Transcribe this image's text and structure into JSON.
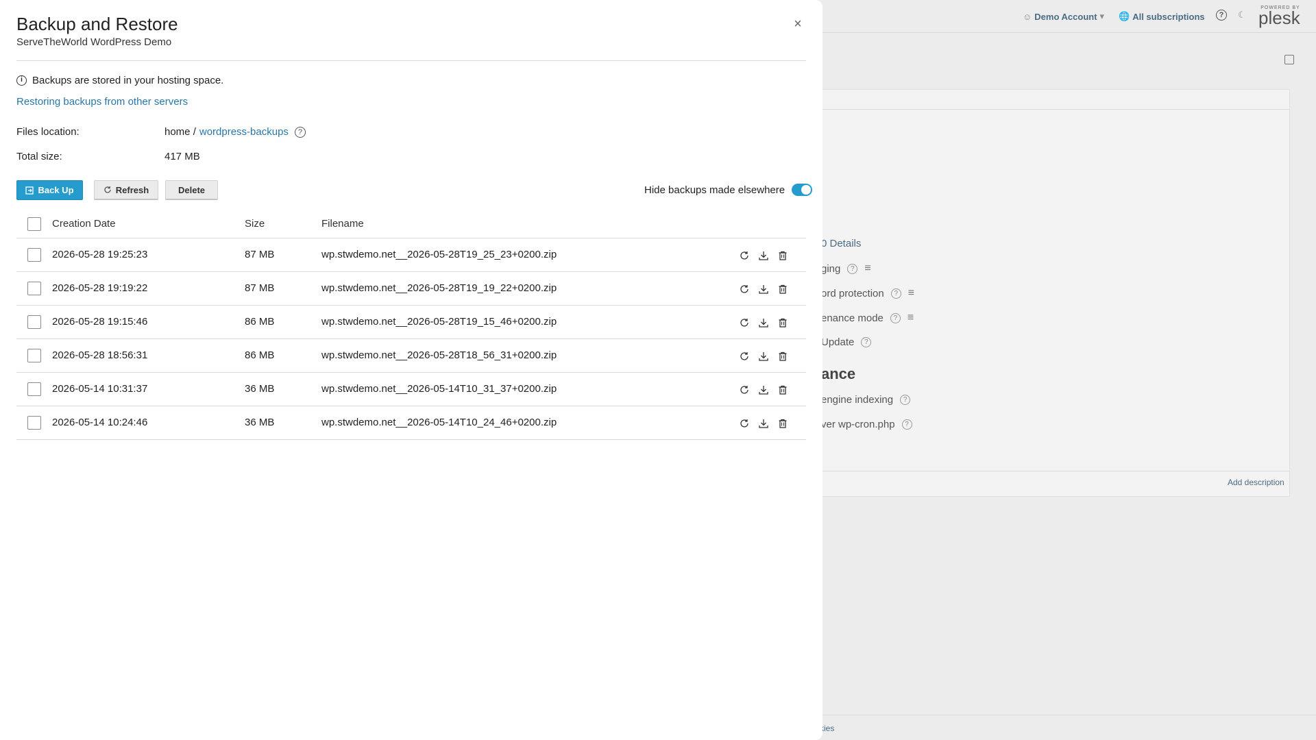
{
  "background": {
    "header": {
      "account_label": "Demo Account",
      "subscriptions_label": "All subscriptions",
      "logo_powered_by": "POWERED BY",
      "logo_text": "plesk"
    },
    "rows": [
      {
        "text": "0 Details"
      },
      {
        "text": "ging"
      },
      {
        "text": "ord protection"
      },
      {
        "text": "enance mode"
      },
      {
        "text": "Update"
      },
      {
        "text": "ance"
      },
      {
        "text": "engine indexing"
      },
      {
        "text": "ver wp-cron.php"
      }
    ],
    "add_description": "Add description",
    "footer_link": "kies"
  },
  "dialog": {
    "title": "Backup and Restore",
    "subtitle": "ServeTheWorld WordPress Demo",
    "info_text": "Backups are stored in your hosting space.",
    "restore_link": "Restoring backups from other servers",
    "files_location_label": "Files location:",
    "files_location_home": "home /",
    "files_location_folder": "wordpress-backups",
    "total_size_label": "Total size:",
    "total_size_value": "417 MB",
    "buttons": {
      "backup": "Back Up",
      "refresh": "Refresh",
      "delete": "Delete"
    },
    "hide_toggle_label": "Hide backups made elsewhere",
    "hide_toggle_on": true,
    "columns": {
      "date": "Creation Date",
      "size": "Size",
      "filename": "Filename"
    },
    "backups": [
      {
        "date": "2026-05-28 19:25:23",
        "size": "87 MB",
        "filename": "wp.stwdemo.net__2026-05-28T19_25_23+0200.zip"
      },
      {
        "date": "2026-05-28 19:19:22",
        "size": "87 MB",
        "filename": "wp.stwdemo.net__2026-05-28T19_19_22+0200.zip"
      },
      {
        "date": "2026-05-28 19:15:46",
        "size": "86 MB",
        "filename": "wp.stwdemo.net__2026-05-28T19_15_46+0200.zip"
      },
      {
        "date": "2026-05-28 18:56:31",
        "size": "86 MB",
        "filename": "wp.stwdemo.net__2026-05-28T18_56_31+0200.zip"
      },
      {
        "date": "2026-05-14 10:31:37",
        "size": "36 MB",
        "filename": "wp.stwdemo.net__2026-05-14T10_31_37+0200.zip"
      },
      {
        "date": "2026-05-14 10:24:46",
        "size": "36 MB",
        "filename": "wp.stwdemo.net__2026-05-14T10_24_46+0200.zip"
      }
    ]
  },
  "colors": {
    "accent": "#259ccc",
    "link": "#2877a8"
  },
  "icons": {
    "close": "close-icon",
    "info": "info-icon",
    "help": "help-icon",
    "restore": "restore-icon",
    "download": "download-icon",
    "delete": "trash-icon"
  }
}
